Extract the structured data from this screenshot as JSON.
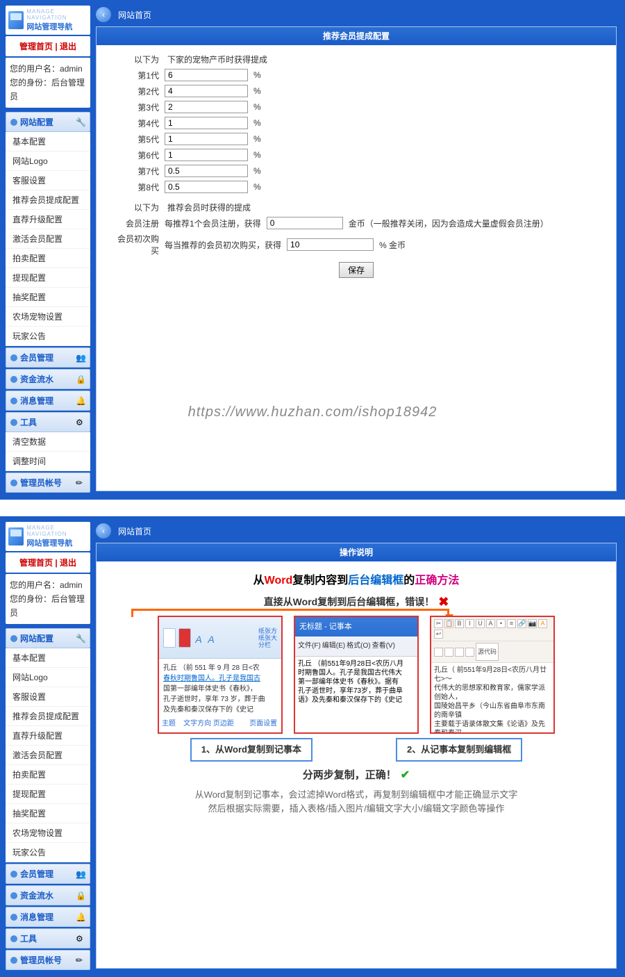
{
  "logo": {
    "title": "网站管理导航",
    "sub": "MANAGE NAVIGATION"
  },
  "nav_top": {
    "home": "管理首页",
    "sep": " | ",
    "logout": "退出"
  },
  "user": {
    "name_label": "您的用户名：",
    "name": "admin",
    "role_label": "您的身份：",
    "role": "后台管理员"
  },
  "menu": {
    "site": {
      "title": "网站配置",
      "items": [
        "基本配置",
        "网站Logo",
        "客服设置",
        "推荐会员提成配置",
        "直荐升级配置",
        "激活会员配置",
        "拍卖配置",
        "提现配置",
        "抽奖配置",
        "农场宠物设置",
        "玩家公告"
      ]
    },
    "member": {
      "title": "会员管理"
    },
    "money": {
      "title": "资金流水"
    },
    "news": {
      "title": "消息管理"
    },
    "tools": {
      "title": "工具",
      "items": [
        "清空数据",
        "调整时间"
      ]
    },
    "admin": {
      "title": "管理员帐号"
    }
  },
  "topbar": {
    "crumb": "网站首页"
  },
  "panel1": {
    "title": "推荐会员提成配置",
    "section1_label": "以下为",
    "section1_desc": "下家的宠物产币时获得提成",
    "gens": [
      {
        "label": "第1代",
        "value": "6",
        "unit": "%"
      },
      {
        "label": "第2代",
        "value": "4",
        "unit": "%"
      },
      {
        "label": "第3代",
        "value": "2",
        "unit": "%"
      },
      {
        "label": "第4代",
        "value": "1",
        "unit": "%"
      },
      {
        "label": "第5代",
        "value": "1",
        "unit": "%"
      },
      {
        "label": "第6代",
        "value": "1",
        "unit": "%"
      },
      {
        "label": "第7代",
        "value": "0.5",
        "unit": "%"
      },
      {
        "label": "第8代",
        "value": "0.5",
        "unit": "%"
      }
    ],
    "section2_label": "以下为",
    "section2_desc": "推荐会员时获得的提成",
    "reg_label": "会员注册",
    "reg_prefix": "每推荐1个会员注册，获得",
    "reg_value": "0",
    "reg_suffix": " 金币（一般推荐关闭，因为会造成大量虚假会员注册）",
    "buy_label": "会员初次购买",
    "buy_prefix": "每当推荐的会员初次购买，获得",
    "buy_value": "10",
    "buy_suffix": "% 金币",
    "save": "保存"
  },
  "watermark": "https://www.huzhan.com/ishop18942",
  "panel2": {
    "title": "操作说明",
    "line1": {
      "a": "从",
      "b": "Word",
      "c": "复制内容到",
      "d": "后台编辑框",
      "e": "的",
      "f": "正确方法"
    },
    "wrong": "直接从Word复制到后台编辑框，错误！",
    "step1": "1、从Word复制到记事本",
    "step2": "2、从记事本复制到编辑框",
    "ok": "分两步复制，正确！",
    "end1": "从Word复制到记事本，会过滤掉Word格式，再复制到编辑框中才能正确显示文字",
    "end2": "然后根据实际需要，插入表格/插入图片/编辑文字大小/编辑文字颜色等操作",
    "word": {
      "tab": "主题",
      "tab2": "页面设置",
      "rt1": "纸张方",
      "rt2": "纸张大",
      "rt3": "分栏",
      "ftxt": "文字方向 页边距",
      "body": "孔丘 （前 551 年 9 月 28 日<农",
      "body2": "春秋时期鲁国人。孔子是我国古",
      "body3": "国第一部编年体史书《春秋》，",
      "body4": "孔子逝世时，享年 73 岁，葬于曲",
      "body5": "及先秦和秦汉保存下的《史记"
    },
    "notepad": {
      "titlebar": "无标题 - 记事本",
      "menu": [
        "文件(F)",
        "编辑(E)",
        "格式(O)",
        "查看(V)"
      ],
      "body": "孔丘 （前551年9月28日<农历八月\n时期鲁国人。孔子是我国古代伟大\n第一部编年体史书《春秋》。据有\n孔子逝世时，享年73岁，葬于曲阜\n语》及先秦和秦汉保存下的《史记"
    },
    "editor": {
      "src": "源代码",
      "body": "孔丘（ 前551年9月28日<农历八月廿七>～\n代伟大的思想家和教育家，儒家学派创始人，\n国陵始昌平乡（今山东省曲阜市东南的南辛镇\n主要载于语录体散文集《论语》及先秦和秦汉"
    }
  }
}
